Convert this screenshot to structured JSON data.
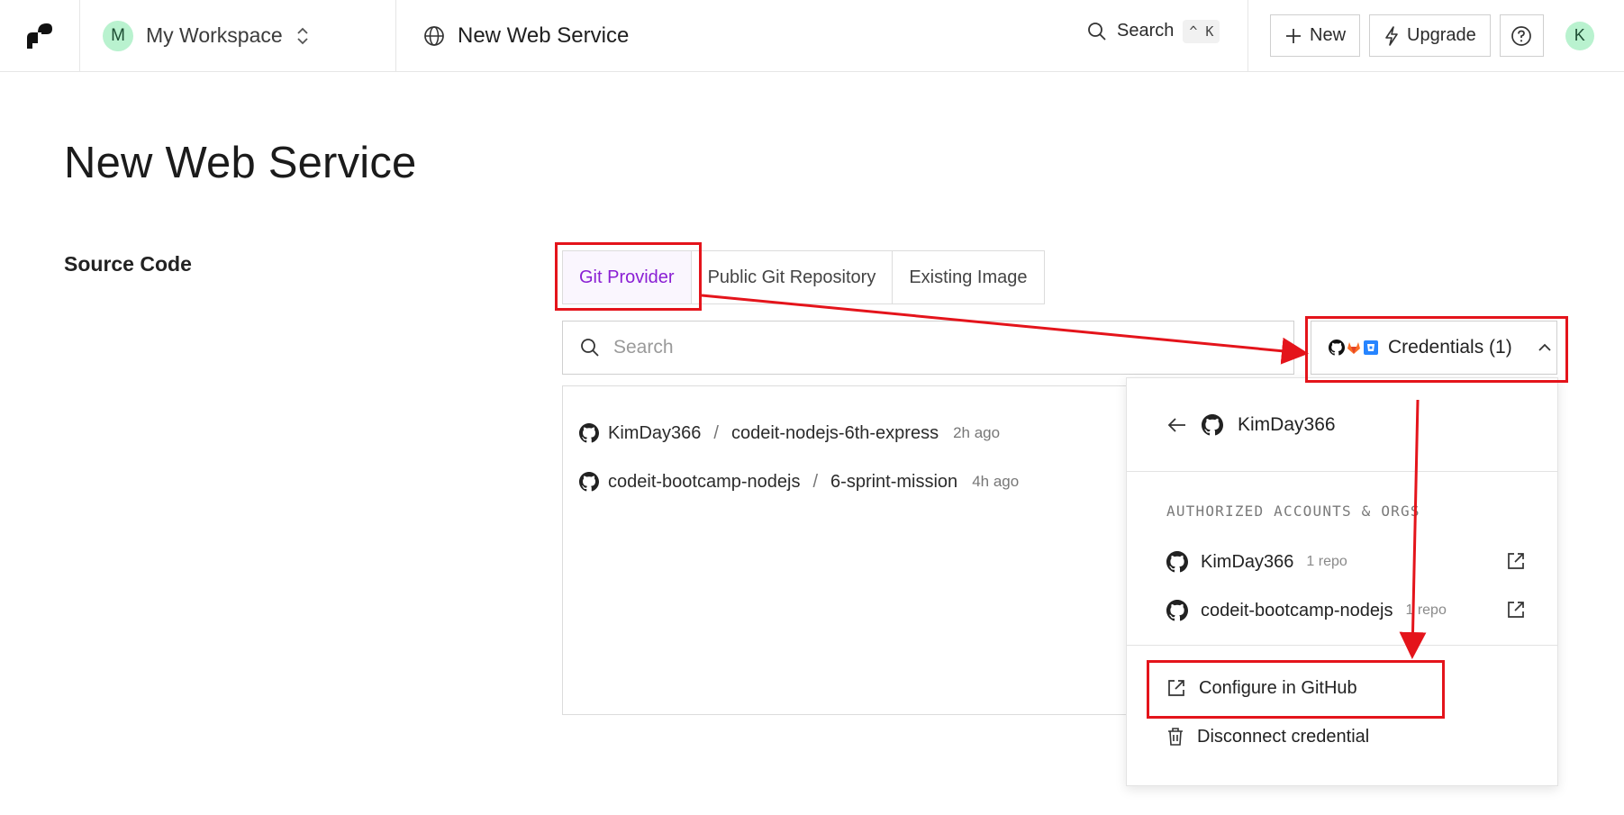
{
  "topbar": {
    "workspace_initial": "M",
    "workspace_name": "My Workspace",
    "page_title": "New Web Service",
    "search_label": "Search",
    "search_shortcut": "^ K",
    "new_label": "New",
    "upgrade_label": "Upgrade",
    "user_initial": "K"
  },
  "main": {
    "title": "New Web Service",
    "section_label": "Source Code",
    "tabs": [
      {
        "label": "Git Provider",
        "active": true
      },
      {
        "label": "Public Git Repository",
        "active": false
      },
      {
        "label": "Existing Image",
        "active": false
      }
    ],
    "search_placeholder": "Search",
    "credentials_label": "Credentials (1)",
    "repos": [
      {
        "owner": "KimDay366",
        "sep": "/",
        "name": "codeit-nodejs-6th-express",
        "time": "2h ago"
      },
      {
        "owner": "codeit-bootcamp-nodejs",
        "sep": "/",
        "name": "6-sprint-mission",
        "time": "4h ago"
      }
    ]
  },
  "dropdown": {
    "account": "KimDay366",
    "caption": "AUTHORIZED ACCOUNTS & ORGS",
    "accounts": [
      {
        "name": "KimDay366",
        "count": "1 repo"
      },
      {
        "name": "codeit-bootcamp-nodejs",
        "count": "1 repo"
      }
    ],
    "configure_label": "Configure in GitHub",
    "disconnect_label": "Disconnect credential"
  },
  "colors": {
    "accent": "#8a1fd4",
    "annotation": "#e4141b",
    "avatar_bg": "#b9f2cf"
  },
  "icons": [
    "render-logo",
    "chevron-updown-icon",
    "globe-icon",
    "search-icon",
    "plus-icon",
    "lightning-icon",
    "help-icon",
    "github-icon",
    "gitlab-icon",
    "bitbucket-icon",
    "chevron-up-icon",
    "arrow-left-icon",
    "external-link-icon",
    "trash-icon"
  ]
}
